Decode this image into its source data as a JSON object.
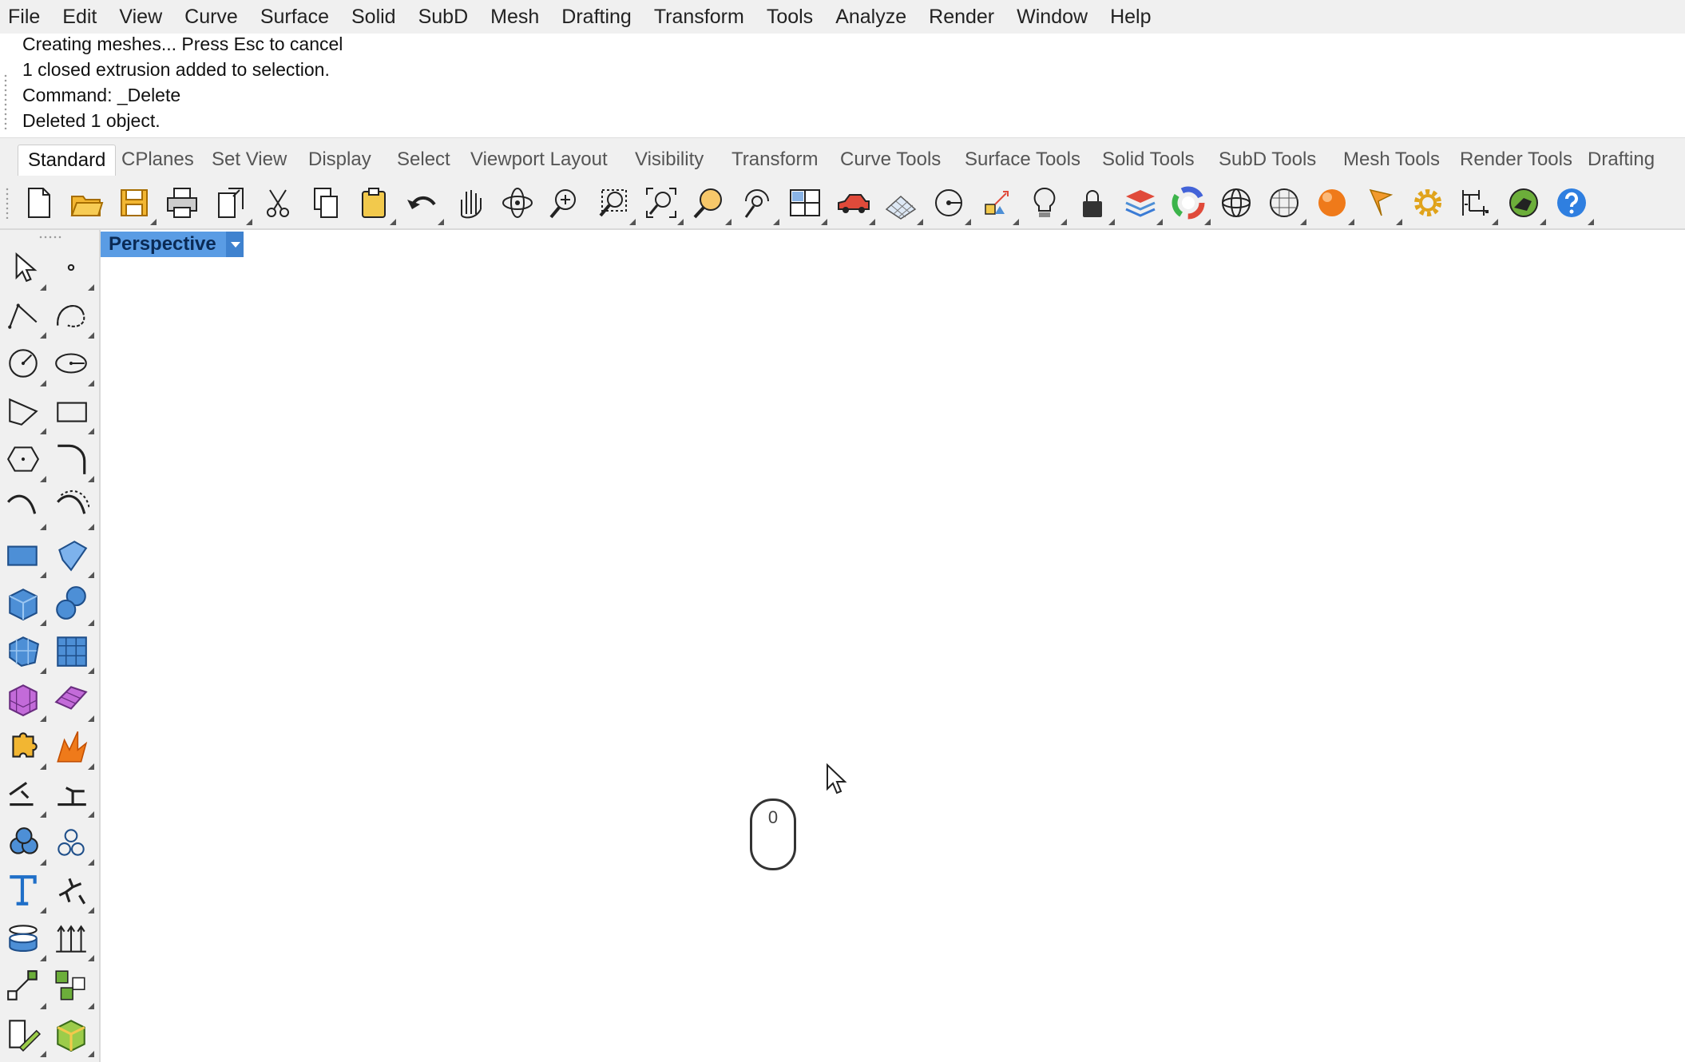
{
  "menu": [
    "File",
    "Edit",
    "View",
    "Curve",
    "Surface",
    "Solid",
    "SubD",
    "Mesh",
    "Drafting",
    "Transform",
    "Tools",
    "Analyze",
    "Render",
    "Window",
    "Help"
  ],
  "command_history": [
    "Creating meshes... Press Esc to cancel",
    "1 closed extrusion added to selection.",
    "Command: _Delete",
    "Deleted 1 object."
  ],
  "tabs": [
    "Standard",
    "CPlanes",
    "Set View",
    "Display",
    "Select",
    "Viewport Layout",
    "Visibility",
    "Transform",
    "Curve Tools",
    "Surface Tools",
    "Solid Tools",
    "SubD Tools",
    "Mesh Tools",
    "Render Tools",
    "Drafting"
  ],
  "active_tab": "Standard",
  "toolbar_icons": [
    "new-file-icon",
    "open-folder-icon",
    "save-icon",
    "print-icon",
    "import-export-icon",
    "cut-icon",
    "copy-icon",
    "paste-icon",
    "undo-icon",
    "pan-hand-icon",
    "rotate-view-icon",
    "zoom-icon",
    "zoom-window-icon",
    "zoom-extents-icon",
    "zoom-selected-icon",
    "rotate-camera-icon",
    "four-viewports-icon",
    "car-icon",
    "grid-icon",
    "cplane-point-icon",
    "gumball-icon",
    "light-bulb-icon",
    "lock-icon",
    "layer-icon",
    "color-wheel-icon",
    "wireframe-sphere-icon",
    "mesh-sphere-icon",
    "rendered-sphere-icon",
    "properties-flag-icon",
    "settings-gear-icon",
    "dimension-icon",
    "grasshopper-icon",
    "help-icon"
  ],
  "sidebar_icons": [
    "select-arrow-icon",
    "point-icon",
    "polyline-icon",
    "curve-icon",
    "circle-icon",
    "ellipse-icon",
    "polygon-icon",
    "rectangle-icon",
    "hexagon-icon",
    "fillet-curve-icon",
    "arc-icon",
    "offset-curve-icon",
    "plane-surface-icon",
    "loft-surface-icon",
    "box-icon",
    "sphere-icon",
    "patch-surface-icon",
    "network-surface-icon",
    "solid-box-icon",
    "twisted-surface-icon",
    "puzzle-icon",
    "explode-icon",
    "split-icon",
    "trim-icon",
    "boolean-union-icon",
    "circles-icon",
    "text-icon",
    "move-figure-icon",
    "cylinder-icon",
    "array-icon",
    "transform-icon",
    "grid-blocks-icon",
    "edit-pencil-icon",
    "green-box-icon"
  ],
  "viewport": {
    "title": "Perspective"
  },
  "mouse_indicator": "0",
  "colors": {
    "accent": "#4d8fd6",
    "panel": "#f0f0f0"
  }
}
